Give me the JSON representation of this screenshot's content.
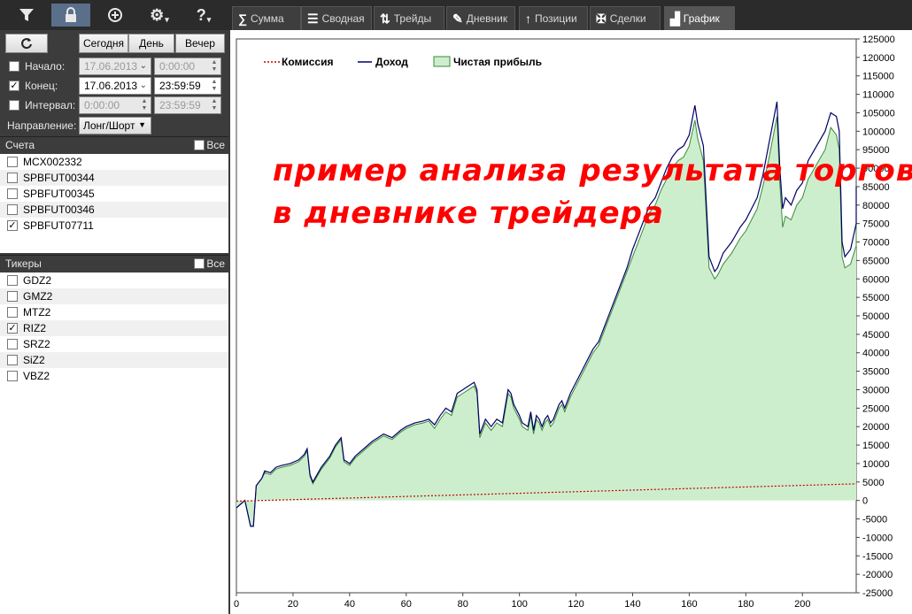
{
  "toolbar": {
    "items": [
      {
        "name": "filter-icon"
      },
      {
        "name": "lock-icon"
      },
      {
        "name": "add-icon"
      },
      {
        "name": "gear-icon",
        "suffix": "▾"
      },
      {
        "name": "help-icon",
        "glyph": "?",
        "suffix": "▾"
      }
    ]
  },
  "date_filter": {
    "refresh_icon": "refresh-icon",
    "today": "Сегодня",
    "day": "День",
    "evening": "Вечер",
    "start_label": "Начало:",
    "start_checked": false,
    "start_date": "17.06.2013",
    "start_time": "0:00:00",
    "end_label": "Конец:",
    "end_checked": true,
    "end_date": "17.06.2013",
    "end_time": "23:59:59",
    "interval_label": "Интервал:",
    "interval_checked": false,
    "interval_time1": "0:00:00",
    "interval_time2": "23:59:59",
    "direction_label": "Направление:",
    "direction_value": "Лонг/Шорт"
  },
  "accounts": {
    "title": "Счета",
    "all_label": "Все",
    "items": [
      {
        "name": "MCX002332",
        "checked": false
      },
      {
        "name": "SPBFUT00344",
        "checked": false
      },
      {
        "name": "SPBFUT00345",
        "checked": false
      },
      {
        "name": "SPBFUT00346",
        "checked": false
      },
      {
        "name": "SPBFUT07711",
        "checked": true
      }
    ]
  },
  "tickers": {
    "title": "Тикеры",
    "all_label": "Все",
    "items": [
      {
        "name": "GDZ2",
        "checked": false
      },
      {
        "name": "GMZ2",
        "checked": false
      },
      {
        "name": "MTZ2",
        "checked": false
      },
      {
        "name": "RIZ2",
        "checked": true
      },
      {
        "name": "SRZ2",
        "checked": false
      },
      {
        "name": "SiZ2",
        "checked": false
      },
      {
        "name": "VBZ2",
        "checked": false
      }
    ]
  },
  "tabs": [
    {
      "label": "Сумма",
      "icon": "sigma-icon",
      "glyph": "∑",
      "active": false
    },
    {
      "label": "Сводная",
      "icon": "list-icon",
      "glyph": "☰",
      "active": false
    },
    {
      "label": "Трейды",
      "icon": "trades-icon",
      "glyph": "⇅",
      "active": false
    },
    {
      "label": "Дневник",
      "icon": "journal-icon",
      "glyph": "✎",
      "active": false
    },
    {
      "label": "Позиции",
      "icon": "position-icon",
      "glyph": "↑",
      "active": false
    },
    {
      "label": "Сделки",
      "icon": "handshake-icon",
      "glyph": "✠",
      "active": false
    },
    {
      "label": "График",
      "icon": "bar-chart-icon",
      "glyph": "▟",
      "active": true
    }
  ],
  "chart_data": {
    "type": "area",
    "xlim": [
      0,
      219
    ],
    "ylim": [
      -25000,
      125000
    ],
    "x_ticks": [
      0,
      20,
      40,
      60,
      80,
      100,
      120,
      140,
      160,
      180,
      200
    ],
    "y_ticks": [
      -25000,
      -20000,
      -15000,
      -10000,
      -5000,
      0,
      5000,
      10000,
      15000,
      20000,
      25000,
      30000,
      35000,
      40000,
      45000,
      50000,
      55000,
      60000,
      65000,
      70000,
      75000,
      80000,
      85000,
      90000,
      95000,
      100000,
      105000,
      110000,
      115000,
      120000,
      125000
    ],
    "legend": [
      "Комиссия",
      "Доход",
      "Чистая прибыль"
    ],
    "legend_position": "top-left",
    "annotation_line1": "пример анализа результата торгов",
    "annotation_line2": "в дневнике трейдера",
    "colors": {
      "commission": "#cc0000",
      "income": "#000066",
      "net_fill": "#cdeecd",
      "net_line": "#3a8a3a",
      "watermark": "#ff0000"
    },
    "income_points": [
      [
        0,
        -2000
      ],
      [
        3,
        0
      ],
      [
        5,
        -7000
      ],
      [
        6,
        -7000
      ],
      [
        7,
        4000
      ],
      [
        9,
        6000
      ],
      [
        10,
        8000
      ],
      [
        12,
        7500
      ],
      [
        14,
        9000
      ],
      [
        16,
        9500
      ],
      [
        19,
        10000
      ],
      [
        22,
        11000
      ],
      [
        24,
        12500
      ],
      [
        25,
        14000
      ],
      [
        26,
        7000
      ],
      [
        27,
        5000
      ],
      [
        30,
        9000
      ],
      [
        33,
        12000
      ],
      [
        35,
        15000
      ],
      [
        37,
        17000
      ],
      [
        38,
        11000
      ],
      [
        40,
        10000
      ],
      [
        42,
        12000
      ],
      [
        45,
        14000
      ],
      [
        48,
        16000
      ],
      [
        50,
        17000
      ],
      [
        52,
        18000
      ],
      [
        55,
        17000
      ],
      [
        58,
        19000
      ],
      [
        60,
        20000
      ],
      [
        63,
        21000
      ],
      [
        66,
        21500
      ],
      [
        68,
        22000
      ],
      [
        70,
        20500
      ],
      [
        72,
        23000
      ],
      [
        74,
        25000
      ],
      [
        76,
        24000
      ],
      [
        78,
        29000
      ],
      [
        80,
        30000
      ],
      [
        82,
        31000
      ],
      [
        84,
        32000
      ],
      [
        85,
        30000
      ],
      [
        86,
        18000
      ],
      [
        88,
        22000
      ],
      [
        90,
        20000
      ],
      [
        92,
        22000
      ],
      [
        94,
        21000
      ],
      [
        96,
        30000
      ],
      [
        97,
        29000
      ],
      [
        98,
        26000
      ],
      [
        100,
        23000
      ],
      [
        101,
        21000
      ],
      [
        103,
        20000
      ],
      [
        104,
        24000
      ],
      [
        105,
        19000
      ],
      [
        106,
        23000
      ],
      [
        107,
        22000
      ],
      [
        108,
        20000
      ],
      [
        109,
        22000
      ],
      [
        110,
        23000
      ],
      [
        111,
        21000
      ],
      [
        112,
        22000
      ],
      [
        114,
        26000
      ],
      [
        115,
        27000
      ],
      [
        116,
        25000
      ],
      [
        118,
        29000
      ],
      [
        120,
        32000
      ],
      [
        122,
        35000
      ],
      [
        124,
        38000
      ],
      [
        126,
        41000
      ],
      [
        128,
        43000
      ],
      [
        130,
        47000
      ],
      [
        132,
        51000
      ],
      [
        134,
        55000
      ],
      [
        136,
        59000
      ],
      [
        138,
        63000
      ],
      [
        140,
        68000
      ],
      [
        142,
        72000
      ],
      [
        144,
        76000
      ],
      [
        146,
        80000
      ],
      [
        148,
        82000
      ],
      [
        150,
        86000
      ],
      [
        152,
        90000
      ],
      [
        154,
        93000
      ],
      [
        156,
        95000
      ],
      [
        158,
        96000
      ],
      [
        160,
        99000
      ],
      [
        162,
        107000
      ],
      [
        163,
        102000
      ],
      [
        165,
        96000
      ],
      [
        167,
        66000
      ],
      [
        169,
        62000
      ],
      [
        170,
        63000
      ],
      [
        172,
        67000
      ],
      [
        175,
        70000
      ],
      [
        178,
        74000
      ],
      [
        180,
        76000
      ],
      [
        182,
        79000
      ],
      [
        184,
        82000
      ],
      [
        186,
        88000
      ],
      [
        188,
        96000
      ],
      [
        190,
        104000
      ],
      [
        191,
        108000
      ],
      [
        192,
        90000
      ],
      [
        193,
        79000
      ],
      [
        194,
        82000
      ],
      [
        196,
        80000
      ],
      [
        198,
        84000
      ],
      [
        200,
        86000
      ],
      [
        202,
        92000
      ],
      [
        205,
        96000
      ],
      [
        208,
        100000
      ],
      [
        210,
        105000
      ],
      [
        212,
        104000
      ],
      [
        213,
        100000
      ],
      [
        214,
        70000
      ],
      [
        215,
        66000
      ],
      [
        217,
        68000
      ],
      [
        219,
        75000
      ],
      [
        220,
        85000
      ]
    ],
    "net_points": [
      [
        0,
        -2000
      ],
      [
        3,
        0
      ],
      [
        5,
        -7000
      ],
      [
        6,
        -7000
      ],
      [
        7,
        4000
      ],
      [
        9,
        6000
      ],
      [
        10,
        7500
      ],
      [
        12,
        7000
      ],
      [
        14,
        8500
      ],
      [
        16,
        9000
      ],
      [
        19,
        9500
      ],
      [
        22,
        10500
      ],
      [
        24,
        12000
      ],
      [
        25,
        13500
      ],
      [
        26,
        6500
      ],
      [
        27,
        4500
      ],
      [
        30,
        8500
      ],
      [
        33,
        11500
      ],
      [
        35,
        14500
      ],
      [
        37,
        16500
      ],
      [
        38,
        10500
      ],
      [
        40,
        9500
      ],
      [
        42,
        11500
      ],
      [
        45,
        13500
      ],
      [
        48,
        15500
      ],
      [
        50,
        16500
      ],
      [
        52,
        17500
      ],
      [
        55,
        16500
      ],
      [
        58,
        18500
      ],
      [
        60,
        19500
      ],
      [
        63,
        20500
      ],
      [
        66,
        21000
      ],
      [
        68,
        21500
      ],
      [
        70,
        19500
      ],
      [
        72,
        22000
      ],
      [
        74,
        24000
      ],
      [
        76,
        23000
      ],
      [
        78,
        28000
      ],
      [
        80,
        29000
      ],
      [
        82,
        30000
      ],
      [
        84,
        31000
      ],
      [
        85,
        29000
      ],
      [
        86,
        17000
      ],
      [
        88,
        21000
      ],
      [
        90,
        19000
      ],
      [
        92,
        21000
      ],
      [
        94,
        20000
      ],
      [
        96,
        29000
      ],
      [
        97,
        28000
      ],
      [
        98,
        25000
      ],
      [
        100,
        22000
      ],
      [
        101,
        20000
      ],
      [
        103,
        19000
      ],
      [
        104,
        23000
      ],
      [
        105,
        18000
      ],
      [
        106,
        22000
      ],
      [
        107,
        21000
      ],
      [
        108,
        19000
      ],
      [
        109,
        21000
      ],
      [
        110,
        22000
      ],
      [
        111,
        20000
      ],
      [
        112,
        21000
      ],
      [
        114,
        25000
      ],
      [
        115,
        26000
      ],
      [
        116,
        24000
      ],
      [
        118,
        28000
      ],
      [
        120,
        31000
      ],
      [
        122,
        34000
      ],
      [
        124,
        37000
      ],
      [
        126,
        40000
      ],
      [
        128,
        42000
      ],
      [
        130,
        46000
      ],
      [
        132,
        50000
      ],
      [
        134,
        54000
      ],
      [
        136,
        58000
      ],
      [
        138,
        62000
      ],
      [
        140,
        66000
      ],
      [
        142,
        70000
      ],
      [
        144,
        74000
      ],
      [
        146,
        78000
      ],
      [
        148,
        80000
      ],
      [
        150,
        84000
      ],
      [
        152,
        87000
      ],
      [
        154,
        90000
      ],
      [
        156,
        92000
      ],
      [
        158,
        93000
      ],
      [
        160,
        96000
      ],
      [
        162,
        103000
      ],
      [
        163,
        98000
      ],
      [
        165,
        92000
      ],
      [
        167,
        63000
      ],
      [
        169,
        60000
      ],
      [
        170,
        61000
      ],
      [
        172,
        64000
      ],
      [
        175,
        67000
      ],
      [
        178,
        71000
      ],
      [
        180,
        73000
      ],
      [
        182,
        76000
      ],
      [
        184,
        79000
      ],
      [
        186,
        85000
      ],
      [
        188,
        92000
      ],
      [
        190,
        100000
      ],
      [
        191,
        104000
      ],
      [
        192,
        86000
      ],
      [
        193,
        74000
      ],
      [
        194,
        77000
      ],
      [
        196,
        76000
      ],
      [
        198,
        80000
      ],
      [
        200,
        82000
      ],
      [
        202,
        87000
      ],
      [
        205,
        91000
      ],
      [
        208,
        95000
      ],
      [
        210,
        101000
      ],
      [
        212,
        99000
      ],
      [
        213,
        95000
      ],
      [
        214,
        66000
      ],
      [
        215,
        63000
      ],
      [
        217,
        64000
      ],
      [
        219,
        69000
      ],
      [
        220,
        78000
      ]
    ],
    "commission_points": [
      [
        0,
        -200
      ],
      [
        220,
        4500
      ]
    ]
  }
}
